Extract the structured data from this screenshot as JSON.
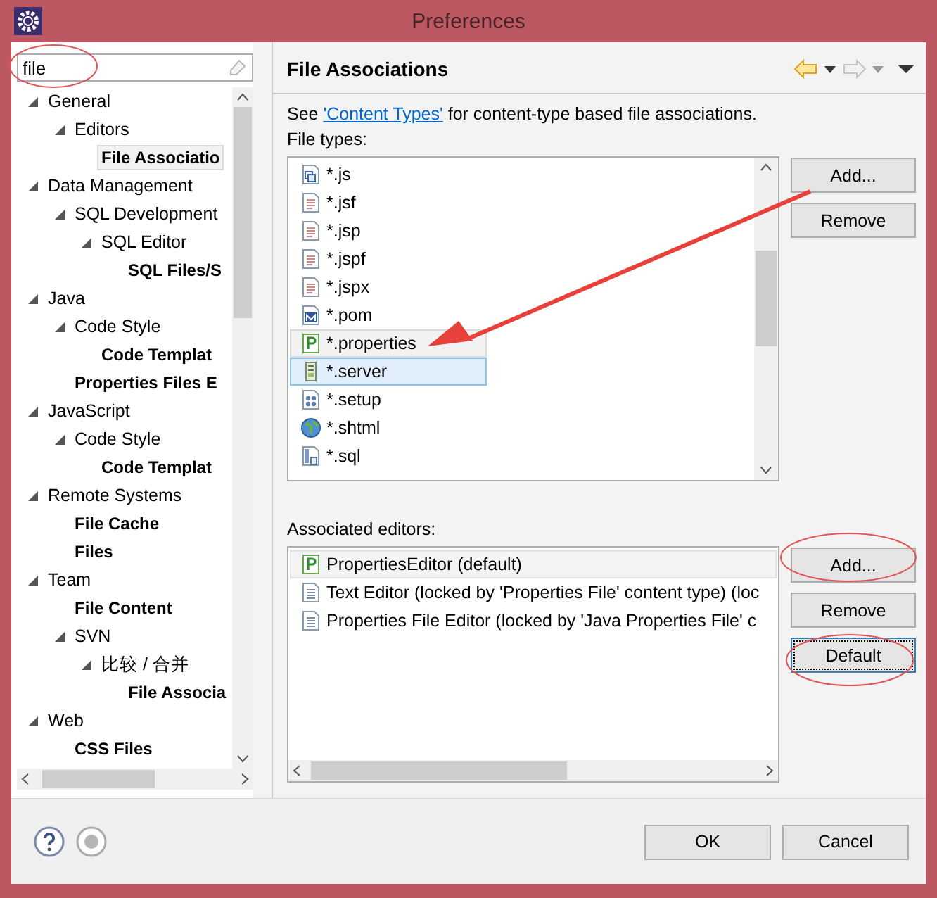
{
  "window": {
    "title": "Preferences"
  },
  "filter": {
    "value": "file",
    "circled": true
  },
  "tree": [
    {
      "label": "General",
      "expanded": true,
      "matched": false,
      "selected": false,
      "children": [
        {
          "label": "Editors",
          "expanded": true,
          "matched": false,
          "selected": false,
          "children": [
            {
              "label": "File Associatio",
              "matched": true,
              "selected": true
            }
          ]
        }
      ]
    },
    {
      "label": "Data Management",
      "expanded": true,
      "matched": false,
      "selected": false,
      "children": [
        {
          "label": "SQL Development",
          "expanded": true,
          "matched": false,
          "selected": false,
          "children": [
            {
              "label": "SQL Editor",
              "expanded": true,
              "matched": false,
              "selected": false,
              "children": [
                {
                  "label": "SQL Files/S",
                  "matched": true,
                  "selected": false
                }
              ]
            }
          ]
        }
      ]
    },
    {
      "label": "Java",
      "expanded": true,
      "matched": false,
      "selected": false,
      "children": [
        {
          "label": "Code Style",
          "expanded": true,
          "matched": false,
          "selected": false,
          "children": [
            {
              "label": "Code Templat",
              "matched": true,
              "selected": false
            }
          ]
        },
        {
          "label": "Properties Files E",
          "matched": true,
          "selected": false
        }
      ]
    },
    {
      "label": "JavaScript",
      "expanded": true,
      "matched": false,
      "selected": false,
      "children": [
        {
          "label": "Code Style",
          "expanded": true,
          "matched": false,
          "selected": false,
          "children": [
            {
              "label": "Code Templat",
              "matched": true,
              "selected": false
            }
          ]
        }
      ]
    },
    {
      "label": "Remote Systems",
      "expanded": true,
      "matched": false,
      "selected": false,
      "children": [
        {
          "label": "File Cache",
          "matched": true,
          "selected": false
        },
        {
          "label": "Files",
          "matched": true,
          "selected": false
        }
      ]
    },
    {
      "label": "Team",
      "expanded": true,
      "matched": false,
      "selected": false,
      "children": [
        {
          "label": "File Content",
          "matched": true,
          "selected": false
        },
        {
          "label": "SVN",
          "expanded": true,
          "matched": false,
          "selected": false,
          "children": [
            {
              "label": "比较 / 合并",
              "expanded": true,
              "matched": false,
              "selected": false,
              "children": [
                {
                  "label": "File Associa",
                  "matched": true,
                  "selected": false
                }
              ]
            }
          ]
        }
      ]
    },
    {
      "label": "Web",
      "expanded": true,
      "matched": false,
      "selected": false,
      "children": [
        {
          "label": "CSS Files",
          "matched": true,
          "selected": false
        }
      ]
    }
  ],
  "page": {
    "title": "File Associations",
    "back": {
      "disabled": false
    },
    "forward": {
      "disabled": true
    },
    "intro": {
      "before": "See ",
      "link": "'Content Types'",
      "after": " for content-type based file associations."
    },
    "file_types": {
      "label": "File types:",
      "arrow": true,
      "items": [
        {
          "label": "*.js",
          "kind": "script",
          "selected": false,
          "hovered": false
        },
        {
          "label": "*.jsf",
          "kind": "page",
          "selected": false,
          "hovered": false
        },
        {
          "label": "*.jsp",
          "kind": "page",
          "selected": false,
          "hovered": false
        },
        {
          "label": "*.jspf",
          "kind": "page",
          "selected": false,
          "hovered": false
        },
        {
          "label": "*.jspx",
          "kind": "page",
          "selected": false,
          "hovered": false
        },
        {
          "label": "*.pom",
          "kind": "maven",
          "selected": false,
          "hovered": false
        },
        {
          "label": "*.properties",
          "kind": "properties",
          "selected": false,
          "hovered": true
        },
        {
          "label": "*.server",
          "kind": "server",
          "selected": true,
          "hovered": false
        },
        {
          "label": "*.setup",
          "kind": "setup",
          "selected": false,
          "hovered": false
        },
        {
          "label": "*.shtml",
          "kind": "globe",
          "selected": false,
          "hovered": false
        },
        {
          "label": "*.sql",
          "kind": "sql",
          "selected": false,
          "hovered": false
        }
      ],
      "buttons": [
        {
          "label": "Add...",
          "circled": false,
          "focused": false
        },
        {
          "label": "Remove",
          "circled": false,
          "focused": false
        }
      ]
    },
    "editors": {
      "label": "Associated editors:",
      "items": [
        {
          "label": "PropertiesEditor (default)",
          "kind": "properties",
          "selected": true
        },
        {
          "label": "Text Editor (locked by 'Properties File' content type) (loc",
          "kind": "text",
          "selected": false
        },
        {
          "label": "Properties File Editor (locked by 'Java Properties File' c",
          "kind": "text",
          "selected": false
        }
      ],
      "buttons": [
        {
          "label": "Add...",
          "circled": true,
          "focused": false
        },
        {
          "label": "Remove",
          "circled": false,
          "focused": false
        },
        {
          "label": "Default",
          "circled": true,
          "focused": true
        }
      ]
    }
  },
  "buttons": [
    {
      "label": "OK"
    },
    {
      "label": "Cancel"
    }
  ]
}
